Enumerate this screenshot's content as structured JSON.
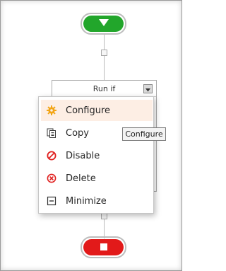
{
  "workflow": {
    "start_icon": "down-triangle-icon",
    "stop_icon": "square-stop-icon",
    "start_color": "#22a62b",
    "stop_color": "#e21a1a",
    "condition_block": {
      "title": "Run if",
      "dropdown_icon": "caret-down-icon"
    }
  },
  "context_menu": {
    "items": [
      {
        "label": "Configure",
        "icon": "gear-icon",
        "color": "#f2a516",
        "highlighted": true
      },
      {
        "label": "Copy",
        "icon": "copy-icon",
        "color": "#3a3a3a",
        "highlighted": false
      },
      {
        "label": "Disable",
        "icon": "disable-icon",
        "color": "#e0201f",
        "highlighted": false
      },
      {
        "label": "Delete",
        "icon": "delete-icon",
        "color": "#e0201f",
        "highlighted": false
      },
      {
        "label": "Minimize",
        "icon": "minimize-icon",
        "color": "#333333",
        "highlighted": false
      }
    ]
  },
  "tooltip": {
    "text": "Configure"
  }
}
